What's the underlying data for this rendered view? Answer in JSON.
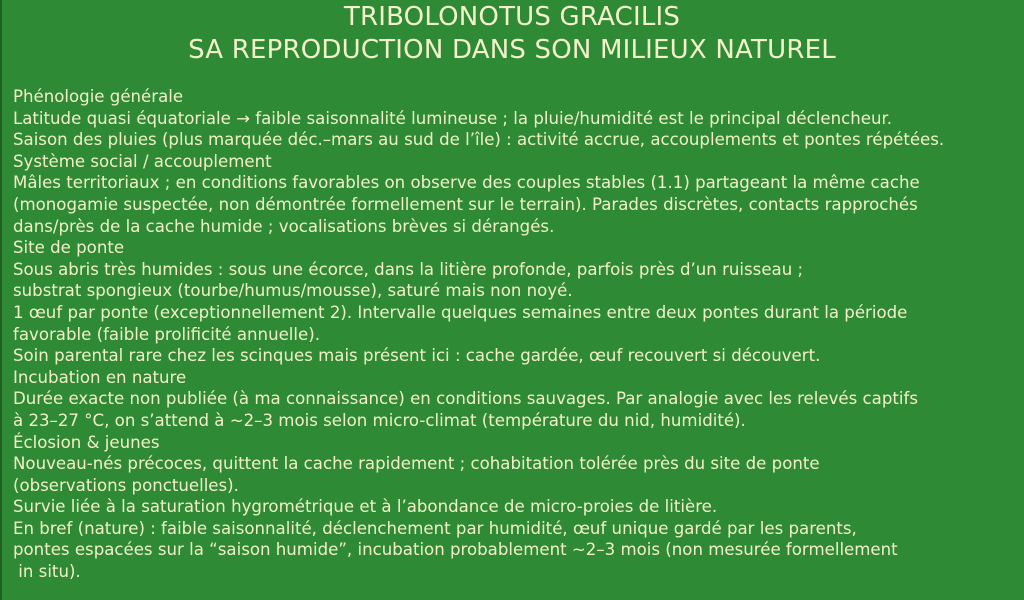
{
  "header": {
    "title_line_1": "TRIBOLONOTUS GRACILIS",
    "title_line_2": "SA REPRODUCTION DANS SON MILIEUX NATUREL"
  },
  "content": {
    "lines": [
      "Phénologie générale",
      "Latitude quasi équatoriale → faible saisonnalité lumineuse ; la pluie/humidité est le principal déclencheur.",
      "Saison des pluies (plus marquée déc.–mars au sud de l’île) : activité accrue, accouplements et pontes répétées.",
      "Système social / accouplement",
      "Mâles territoriaux ; en conditions favorables on observe des couples stables (1.1) partageant la même cache",
      "(monogamie suspectée, non démontrée formellement sur le terrain). Parades discrètes, contacts rapprochés",
      "dans/près de la cache humide ; vocalisations brèves si dérangés.",
      "Site de ponte",
      "Sous abris très humides : sous une écorce, dans la litière profonde, parfois près d’un ruisseau ;",
      "substrat spongieux (tourbe/humus/mousse), saturé mais non noyé.",
      "1 œuf par ponte (exceptionnellement 2). Intervalle quelques semaines entre deux pontes durant la période",
      "favorable (faible prolificité annuelle).",
      "Soin parental rare chez les scinques mais présent ici : cache gardée, œuf recouvert si découvert.",
      "Incubation en nature",
      "Durée exacte non publiée (à ma connaissance) en conditions sauvages. Par analogie avec les relevés captifs",
      "à 23–27 °C, on s’attend à ~2–3 mois selon micro-climat (température du nid, humidité).",
      "Éclosion & jeunes",
      "Nouveau-nés précoces, quittent la cache rapidement ; cohabitation tolérée près du site de ponte",
      "(observations ponctuelles).",
      "Survie liée à la saturation hygrométrique et à l’abondance de micro-proies de litière.",
      "En bref (nature) : faible saisonnalité, déclenchement par humidité, œuf unique gardé par les parents,",
      "pontes espacées sur la “saison humide”, incubation probablement ~2–3 mois (non mesurée formellement",
      " in situ)."
    ]
  },
  "colors": {
    "background": "#2e8a35",
    "text": "#f2f0c8",
    "left_edge": "#1f5f24"
  }
}
